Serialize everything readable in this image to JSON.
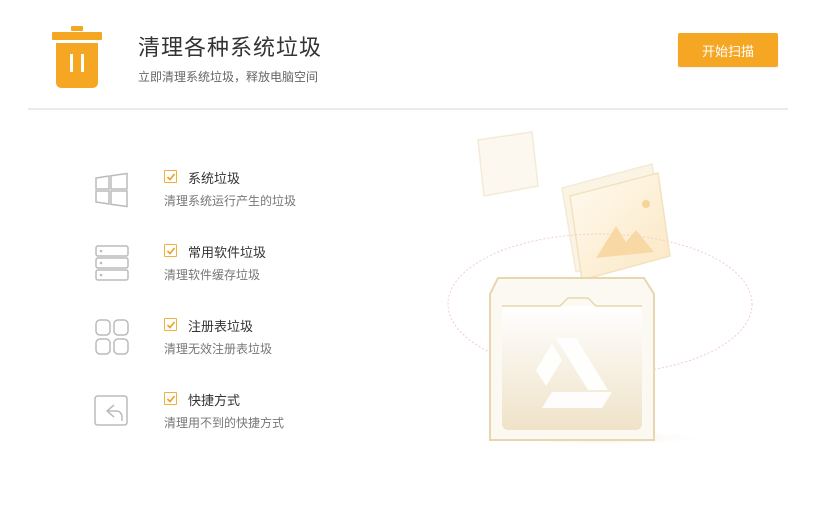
{
  "header": {
    "title": "清理各种系统垃圾",
    "subtitle": "立即清理系统垃圾，释放电脑空间",
    "scan_button_label": "开始扫描",
    "icon": "trash-icon"
  },
  "items": [
    {
      "title": "系统垃圾",
      "desc": "清理系统运行产生的垃圾",
      "checked": true,
      "icon": "windows-icon"
    },
    {
      "title": "常用软件垃圾",
      "desc": "清理软件缓存垃圾",
      "checked": true,
      "icon": "database-icon"
    },
    {
      "title": "注册表垃圾",
      "desc": "清理无效注册表垃圾",
      "checked": true,
      "icon": "grid-icon"
    },
    {
      "title": "快捷方式",
      "desc": "清理用不到的快捷方式",
      "checked": true,
      "icon": "shortcut-icon"
    }
  ],
  "colors": {
    "accent": "#f5a623",
    "checkbox_border": "#f0b040"
  }
}
